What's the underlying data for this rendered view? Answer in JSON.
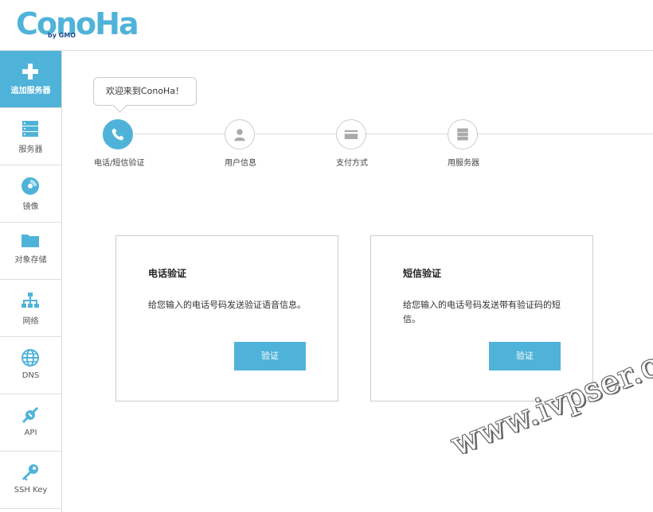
{
  "brand": {
    "logo": "ConoHa",
    "byline": "by GMO"
  },
  "sidebar": {
    "items": [
      {
        "label": "追加服务器",
        "icon": "plus-icon"
      },
      {
        "label": "服务器",
        "icon": "server-icon"
      },
      {
        "label": "镜像",
        "icon": "disc-icon"
      },
      {
        "label": "对象存储",
        "icon": "folder-icon"
      },
      {
        "label": "网络",
        "icon": "network-icon"
      },
      {
        "label": "DNS",
        "icon": "globe-icon"
      },
      {
        "label": "API",
        "icon": "api-icon"
      },
      {
        "label": "SSH Key",
        "icon": "key-icon"
      }
    ]
  },
  "welcome": "欢迎来到ConoHa！",
  "steps": [
    {
      "label": "电话/短信验证",
      "icon": "phone-icon"
    },
    {
      "label": "用户信息",
      "icon": "user-icon"
    },
    {
      "label": "支付方式",
      "icon": "credit-card-icon"
    },
    {
      "label": "用服务器",
      "icon": "server-icon"
    }
  ],
  "cards": [
    {
      "title": "电话验证",
      "desc": "给您输入的电话号码发送验证语音信息。",
      "button": "验证"
    },
    {
      "title": "短信验证",
      "desc": "给您输入的电话号码发送带有验证码的短信。",
      "button": "验证"
    }
  ],
  "watermark": "www.ivpser.com",
  "colors": {
    "accent": "#4fb3d9",
    "border": "#dddddd"
  }
}
